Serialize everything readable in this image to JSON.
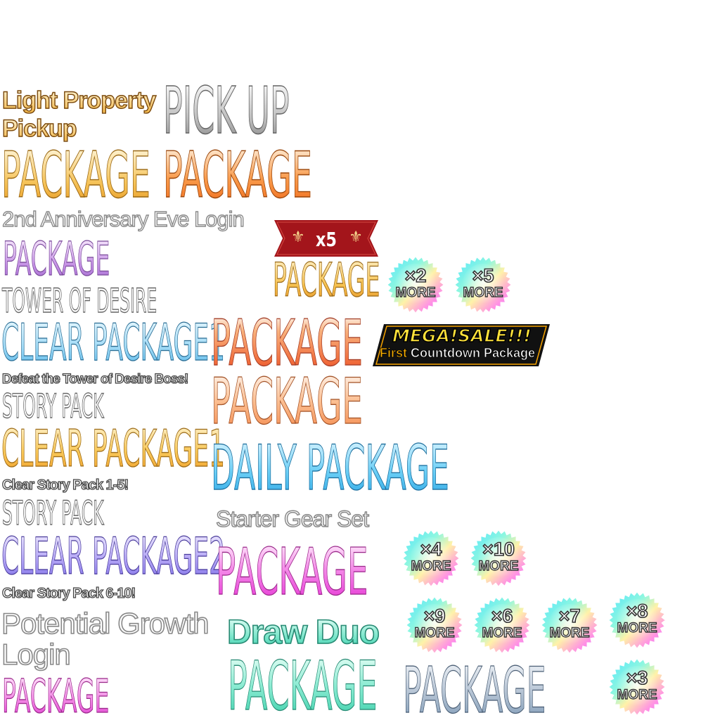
{
  "labels": {
    "light_property": "Light Property",
    "pickup": "Pickup",
    "pick_up": "PICK UP",
    "package": "PACKAGE",
    "anniversary": "2nd Anniversary Eve Login",
    "tower": "TOWER OF DESIRE",
    "clear_package1": "CLEAR PACKAGE1",
    "clear_package2": "CLEAR PACKAGE2",
    "defeat": "Defeat the Tower of Desire Boss!",
    "story_pack": "STORY PACK",
    "clear_story_1_5": "Clear Story Pack 1-5!",
    "clear_story_6_10": "Clear Story Pack 6-10!",
    "potential_growth": "Potential Growth",
    "login": "Login",
    "daily_package": "DAILY PACKAGE",
    "starter_gear": "Starter Gear Set",
    "draw_duo": "Draw Duo"
  },
  "ribbon": {
    "text": "x5"
  },
  "mega_sale": {
    "title": "MEGA!SALE!!!",
    "first": "First",
    "rest": " Countdown Package"
  },
  "badges": [
    {
      "mult": "×2",
      "more": "MORE"
    },
    {
      "mult": "×5",
      "more": "MORE"
    },
    {
      "mult": "×4",
      "more": "MORE"
    },
    {
      "mult": "×10",
      "more": "MORE"
    },
    {
      "mult": "×9",
      "more": "MORE"
    },
    {
      "mult": "×6",
      "more": "MORE"
    },
    {
      "mult": "×7",
      "more": "MORE"
    },
    {
      "mult": "×8",
      "more": "MORE"
    },
    {
      "mult": "×3",
      "more": "MORE"
    }
  ],
  "colors": {
    "gold": "#f6b93b",
    "orange": "#f7883a",
    "silver": "#9e9e9e",
    "lavender": "#b58ad8",
    "sky": "#5bc4ef",
    "violet": "#8f7ef0",
    "magenta": "#ee3ad7",
    "mint": "#5fe0c2",
    "steel": "#7f9bb7",
    "ribbon_red": "#a3151b"
  }
}
